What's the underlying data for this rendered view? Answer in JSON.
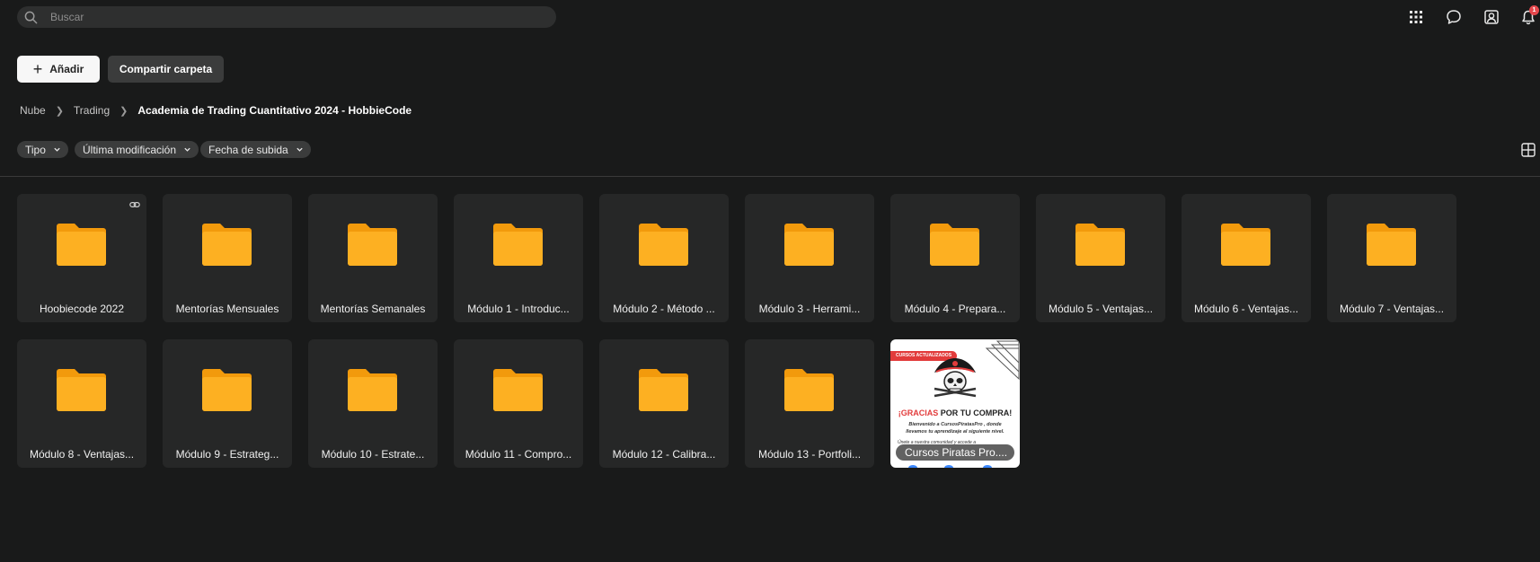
{
  "search": {
    "placeholder": "Buscar"
  },
  "topbar": {
    "icons": [
      "apps-grid-icon",
      "chat-icon",
      "account-icon",
      "bell-icon"
    ],
    "notification_count": "1"
  },
  "actions": {
    "add_label": "Añadir",
    "share_label": "Compartir carpeta"
  },
  "breadcrumb": [
    "Nube",
    "Trading",
    "Academia de Trading Cuantitativo 2024 - HobbieCode"
  ],
  "filters": [
    "Tipo",
    "Última modificación",
    "Fecha de subida"
  ],
  "items": [
    {
      "name": "Hoobiecode 2022",
      "type": "folder",
      "shared_link": true
    },
    {
      "name": "Mentorías Mensuales",
      "type": "folder"
    },
    {
      "name": "Mentorías Semanales",
      "type": "folder"
    },
    {
      "name": "Módulo 1 - Introduc...",
      "type": "folder"
    },
    {
      "name": "Módulo 2 - Método ...",
      "type": "folder"
    },
    {
      "name": "Módulo 3 - Herrami...",
      "type": "folder"
    },
    {
      "name": "Módulo 4 - Prepara...",
      "type": "folder"
    },
    {
      "name": "Módulo 5 - Ventajas...",
      "type": "folder"
    },
    {
      "name": "Módulo 6 - Ventajas...",
      "type": "folder"
    },
    {
      "name": "Módulo 7 - Ventajas...",
      "type": "folder"
    },
    {
      "name": "Módulo 8 - Ventajas...",
      "type": "folder"
    },
    {
      "name": "Módulo 9 - Estrateg...",
      "type": "folder"
    },
    {
      "name": "Módulo 10 - Estrate...",
      "type": "folder"
    },
    {
      "name": "Módulo 11 - Compro...",
      "type": "folder"
    },
    {
      "name": "Módulo 12 - Calibra...",
      "type": "folder"
    },
    {
      "name": "Módulo 13 - Portfoli...",
      "type": "folder"
    },
    {
      "name": "Cursos Piratas Pro....",
      "type": "image",
      "thumbnail": {
        "tag": "CURSOS ACTUALIZADOS",
        "headline_red": "¡GRACIAS",
        "headline_rest": " POR TU COMPRA!",
        "line1": "Bienvenido a CursosPiratasPro , donde",
        "line2": "llevamos tu aprendizaje al siguiente nivel.",
        "line3": "Únete a nuestra comunidad y accede a"
      }
    }
  ],
  "colors": {
    "folder": "#fdb022",
    "folder_dark": "#f29a0c",
    "accent_red": "#e23b3b",
    "background": "#191a1a",
    "card": "#262727"
  }
}
